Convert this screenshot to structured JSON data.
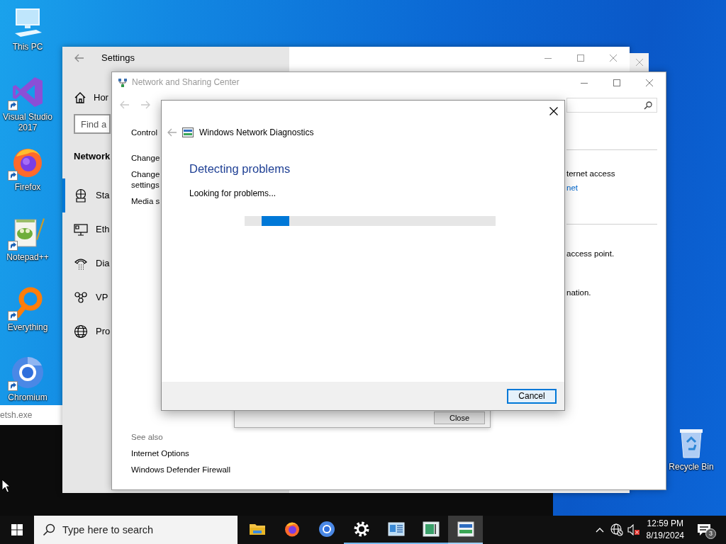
{
  "desktop_icons": [
    {
      "label": "This PC",
      "kind": "pc",
      "shortcut": false
    },
    {
      "label": "Visual Studio 2017",
      "kind": "ide",
      "shortcut": true
    },
    {
      "label": "Firefox",
      "kind": "firefox",
      "shortcut": true
    },
    {
      "label": "Notepad++",
      "kind": "notepad",
      "shortcut": true
    },
    {
      "label": "Everything",
      "kind": "everything",
      "shortcut": true
    },
    {
      "label": "Chromium",
      "kind": "chromium",
      "shortcut": true
    }
  ],
  "recycle_bin": {
    "label": "Recycle Bin"
  },
  "console_window": {
    "text": "etsh.exe"
  },
  "settings_window": {
    "title": "Settings",
    "home_label": "Hor",
    "search": {
      "placeholder": "Find a"
    },
    "section_title": "Network",
    "items": [
      {
        "label": "Sta",
        "kind": "status",
        "selected": true
      },
      {
        "label": "Eth",
        "kind": "ethernet",
        "selected": false
      },
      {
        "label": "Dia",
        "kind": "dialup",
        "selected": false
      },
      {
        "label": "VP",
        "kind": "vpn",
        "selected": false
      },
      {
        "label": "Pro",
        "kind": "proxy",
        "selected": false
      }
    ]
  },
  "network_window": {
    "title": "Network and Sharing Center",
    "nav_title": "Control",
    "links": [
      "Change",
      "Change\nsettings",
      "Media s"
    ],
    "access_text": "ternet access",
    "connection_link": "net",
    "task_texts": [
      "access point.",
      "nation."
    ],
    "see_also": {
      "title": "See also",
      "links": [
        "Internet Options",
        "Windows Defender Firewall"
      ]
    }
  },
  "background_dialog": {
    "button": "Close"
  },
  "diagnostics_dialog": {
    "title": "Windows Network Diagnostics",
    "heading": "Detecting problems",
    "status": "Looking for problems...",
    "progress": {
      "level": 0.11
    },
    "button": "Cancel"
  },
  "taskbar": {
    "search": {
      "placeholder": "Type here to search"
    },
    "apps": [
      {
        "kind": "folder",
        "running": false,
        "active": false
      },
      {
        "kind": "firefox",
        "running": false,
        "active": false
      },
      {
        "kind": "chromium",
        "running": false,
        "active": false
      },
      {
        "kind": "settings",
        "running": true,
        "active": false
      },
      {
        "kind": "control",
        "running": true,
        "active": false
      },
      {
        "kind": "sharing",
        "running": true,
        "active": false
      },
      {
        "kind": "diagnostics",
        "running": true,
        "active": true
      }
    ],
    "tray": {
      "time": "12:59 PM",
      "date": "8/19/2024",
      "notifications": "3"
    }
  }
}
